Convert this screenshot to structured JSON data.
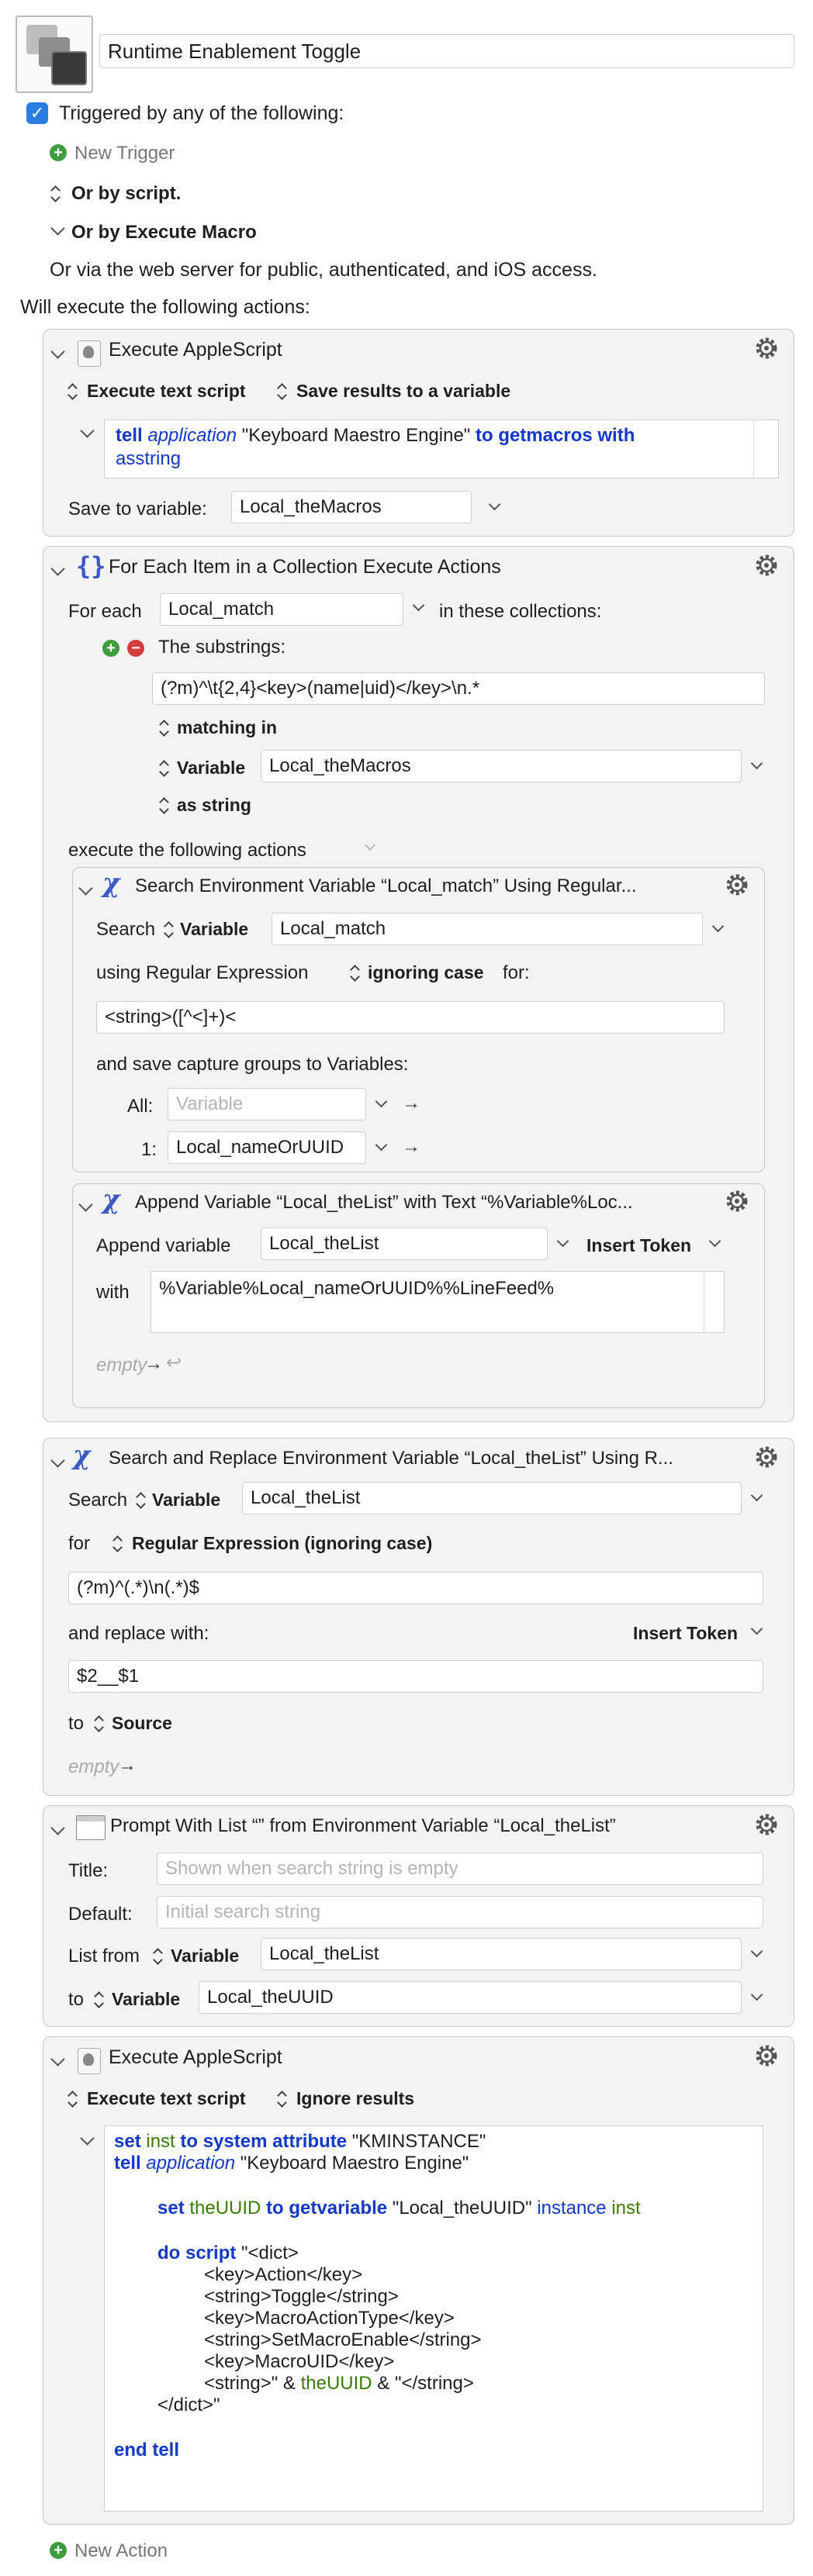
{
  "macro": {
    "name": "Runtime Enablement Toggle",
    "triggered_label": "Triggered by any of the following:",
    "new_trigger": "New Trigger",
    "or_by_script": "Or by script.",
    "or_by_execute_macro": "Or by Execute Macro",
    "web_server_text": "Or via the web server for public, authenticated, and iOS access.",
    "will_execute": "Will execute the following actions:",
    "new_action": "New Action"
  },
  "action1": {
    "title": "Execute AppleScript",
    "mode": "Execute text script",
    "results": "Save results to a variable",
    "code": {
      "tell": "tell",
      "application": "application",
      "engine": "\"Keyboard Maestro Engine\"",
      "to": "to",
      "getmacros": "getmacros",
      "with": "with",
      "asstring": "asstring"
    },
    "save_label": "Save to variable:",
    "save_value": "Local_theMacros"
  },
  "action2": {
    "title": "For Each Item in a Collection Execute Actions",
    "for_each": "For each",
    "variable": "Local_match",
    "in_collections": "in these collections:",
    "substrings_label": "The substrings:",
    "regex": "(?m)^\\t{2,4}<key>(name|uid)</key>\\n.*",
    "matching_in": "matching in",
    "variable_label": "Variable",
    "variable_value": "Local_theMacros",
    "as_string": "as string",
    "execute_following": "execute the following actions"
  },
  "action2a": {
    "title": "Search Environment Variable “Local_match” Using Regular...",
    "search": "Search",
    "variable_label": "Variable",
    "variable_value": "Local_match",
    "using_regex": "using Regular Expression",
    "ignoring_case": "ignoring case",
    "for": "for:",
    "regex": "<string>([^<]+)<",
    "save_groups": "and save capture groups to Variables:",
    "all_label": "All:",
    "all_placeholder": "Variable",
    "one_label": "1:",
    "one_value": "Local_nameOrUUID"
  },
  "action2b": {
    "title": "Append Variable “Local_theList” with Text “%Variable%Loc...",
    "append_label": "Append variable",
    "append_value": "Local_theList",
    "insert_token": "Insert Token",
    "with_label": "with",
    "with_value": "%Variable%Local_nameOrUUID%%LineFeed%",
    "empty": "empty"
  },
  "action3": {
    "title": "Search and Replace Environment Variable “Local_theList” Using R...",
    "search": "Search",
    "variable_label": "Variable",
    "variable_value": "Local_theList",
    "for_label": "for",
    "regex_mode": "Regular Expression (ignoring case)",
    "regex": "(?m)^(.*)\\n(.*)$",
    "replace_label": "and replace with:",
    "insert_token": "Insert Token",
    "replace_value": "$2__$1",
    "to_label": "to",
    "to_value": "Source",
    "empty": "empty"
  },
  "action4": {
    "title": "Prompt With List “” from Environment Variable “Local_theList”",
    "title_label": "Title:",
    "title_placeholder": "Shown when search string is empty",
    "default_label": "Default:",
    "default_placeholder": "Initial search string",
    "list_from": "List from",
    "variable_label": "Variable",
    "list_value": "Local_theList",
    "to_label": "to",
    "to_value": "Local_theUUID"
  },
  "action5": {
    "title": "Execute AppleScript",
    "mode": "Execute text script",
    "results": "Ignore results",
    "code": {
      "set": "set",
      "inst": "inst",
      "to": "to",
      "system_attribute": "system attribute",
      "kminstance": "\"KMINSTANCE\"",
      "tell": "tell",
      "application": "application",
      "engine": "\"Keyboard Maestro Engine\"",
      "theUUID": "theUUID",
      "getvariable": "getvariable",
      "local_uuid": "\"Local_theUUID\"",
      "instance": "instance",
      "do_script": "do script",
      "dict_open": "\"<dict>",
      "l1": "<key>Action</key>",
      "l2": "<string>Toggle</string>",
      "l3": "<key>MacroActionType</key>",
      "l4": "<string>SetMacroEnable</string>",
      "l5": "<key>MacroUID</key>",
      "l6a": "<string>\" & ",
      "l6c": " & \"</string>",
      "dict_close": "</dict>\"",
      "end_tell": "end tell"
    }
  }
}
